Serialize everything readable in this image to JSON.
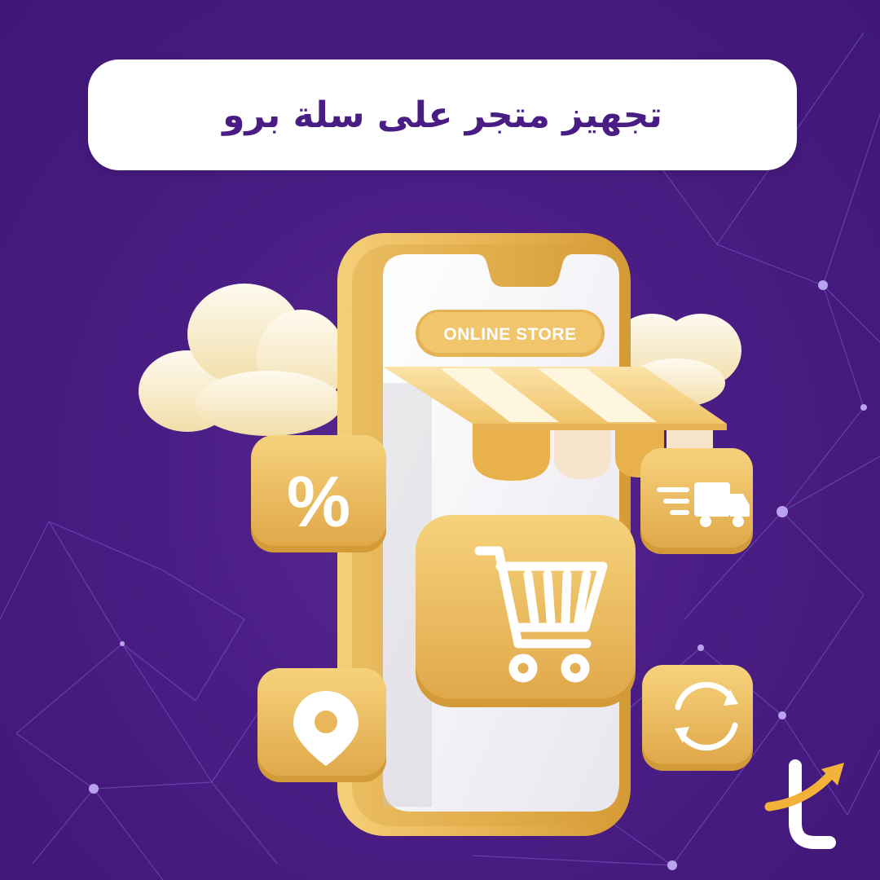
{
  "banner": {
    "title": "تجهيز متجر على سلة برو"
  },
  "phone": {
    "sign_label": "ONLINE STORE"
  },
  "tiles": {
    "discount_symbol": "%"
  },
  "icons": {
    "discount": "percent-icon",
    "cart": "shopping-cart-icon",
    "delivery": "delivery-truck-icon",
    "location": "location-pin-icon",
    "refresh": "refresh-icon",
    "logo": "brand-logo-icon"
  },
  "colors": {
    "background": "#4a1d84",
    "accent_gold": "#f0c86a",
    "gold_dark": "#d9a540",
    "cream": "#f8e9c0",
    "title_text": "#4a1d84"
  }
}
